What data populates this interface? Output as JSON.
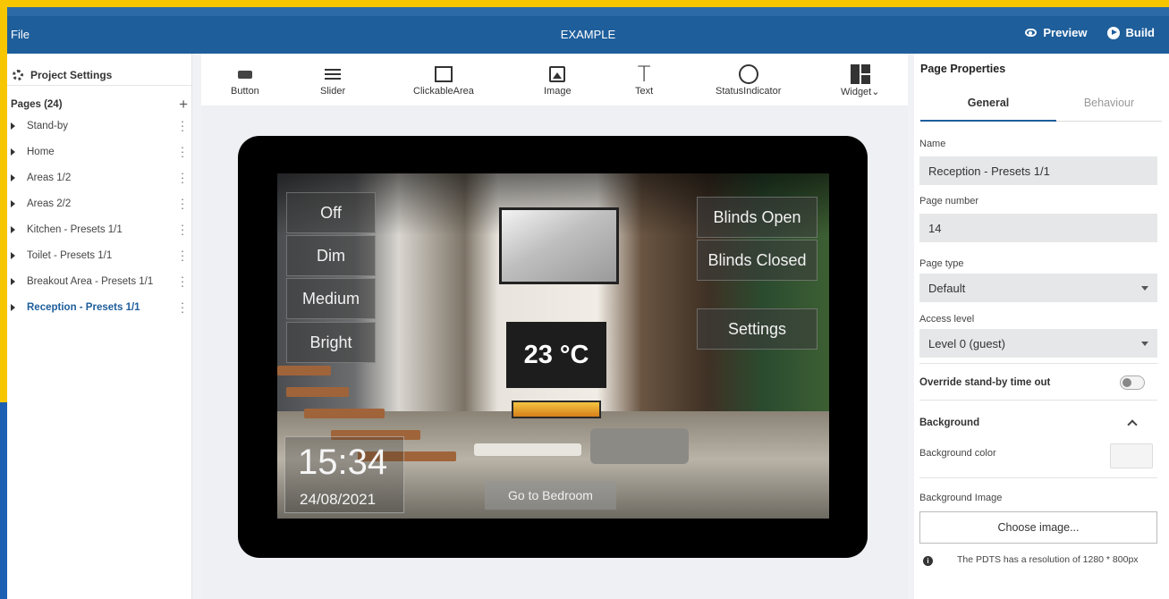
{
  "app": {
    "file_menu": "File",
    "project_title": "EXAMPLE",
    "preview_label": "Preview",
    "build_label": "Build"
  },
  "sidebar": {
    "project_settings": "Project Settings",
    "pages_header": "Pages (24)",
    "pages": [
      {
        "label": "Stand-by"
      },
      {
        "label": "Home"
      },
      {
        "label": "Areas 1/2"
      },
      {
        "label": "Areas 2/2"
      },
      {
        "label": "Kitchen - Presets 1/1"
      },
      {
        "label": "Toilet - Presets 1/1"
      },
      {
        "label": "Breakout Area - Presets 1/1"
      },
      {
        "label": "Reception - Presets 1/1",
        "active": true
      }
    ]
  },
  "toolbar": {
    "tools": [
      {
        "label": "Button",
        "icon": "button-icon"
      },
      {
        "label": "Slider",
        "icon": "slider-icon"
      },
      {
        "label": "ClickableArea",
        "icon": "clickable-area-icon"
      },
      {
        "label": "Image",
        "icon": "image-icon"
      },
      {
        "label": "Text",
        "icon": "text-icon"
      },
      {
        "label": "StatusIndicator",
        "icon": "status-indicator-icon"
      },
      {
        "label": "Widget",
        "icon": "widget-icon"
      }
    ]
  },
  "screen": {
    "buttons_left": [
      "Off",
      "Dim",
      "Medium",
      "Bright"
    ],
    "buttons_right": [
      "Blinds Open",
      "Blinds Closed",
      "Settings"
    ],
    "temperature": "23 °C",
    "time": "15:34",
    "date": "24/08/2021",
    "go_to_bedroom": "Go to Bedroom"
  },
  "panel": {
    "title": "Page Properties",
    "tab_general": "General",
    "tab_behaviour": "Behaviour",
    "name_label": "Name",
    "name_value": "Reception - Presets 1/1",
    "page_number_label": "Page number",
    "page_number_value": "14",
    "page_type_label": "Page type",
    "page_type_value": "Default",
    "access_level_label": "Access level",
    "access_level_value": "Level 0 (guest)",
    "override_label": "Override stand-by time out",
    "override_enabled": false,
    "background_header": "Background",
    "background_color_label": "Background color",
    "background_image_label": "Background Image",
    "choose_image": "Choose image...",
    "info_text": "The PDTS has a resolution of 1280 * 800px"
  },
  "colors": {
    "appbar": "#1e5e9b",
    "accent": "#1e5e9b",
    "frame_yellow": "#f7c600",
    "frame_blue": "#1d5fb3"
  }
}
